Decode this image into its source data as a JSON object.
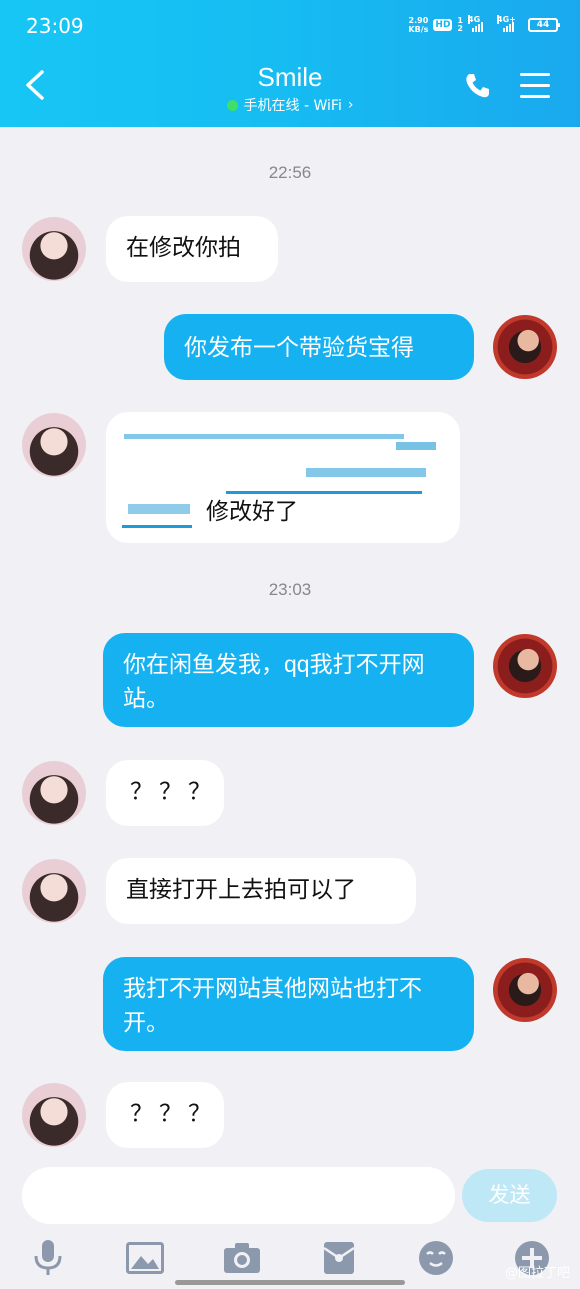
{
  "status": {
    "time": "23:09",
    "speed_value": "2.90",
    "speed_unit": "KB/s",
    "hd": "HD",
    "sim1": "1",
    "sim2": "2",
    "net1": "4G",
    "net2": "4G+",
    "battery": "44"
  },
  "header": {
    "title": "Smile",
    "subtitle": "手机在线 - WiFi",
    "chevron": "›"
  },
  "messages": {
    "ts1": "22:56",
    "m1": "在修改你拍",
    "m2": "你发布一个带验货宝得",
    "m3": "修改好了",
    "ts2": "23:03",
    "m4": "你在闲鱼发我，qq我打不开网站。",
    "m5": "？？？",
    "m6": "直接打开上去拍可以了",
    "m7": "我打不开网站其他网站也打不开。",
    "m8": "？？？"
  },
  "input": {
    "placeholder": "",
    "send_label": "发送"
  },
  "toolbar": {
    "items": [
      "mic-icon",
      "image-icon",
      "camera-icon",
      "red-packet-icon",
      "emoji-icon",
      "plus-icon"
    ]
  },
  "watermark": "@图拉丁吧",
  "colors": {
    "header": "#17c6f5",
    "bubble_out": "#16b1f0",
    "bubble_in": "#ffffff",
    "background": "#f0f0f5"
  }
}
